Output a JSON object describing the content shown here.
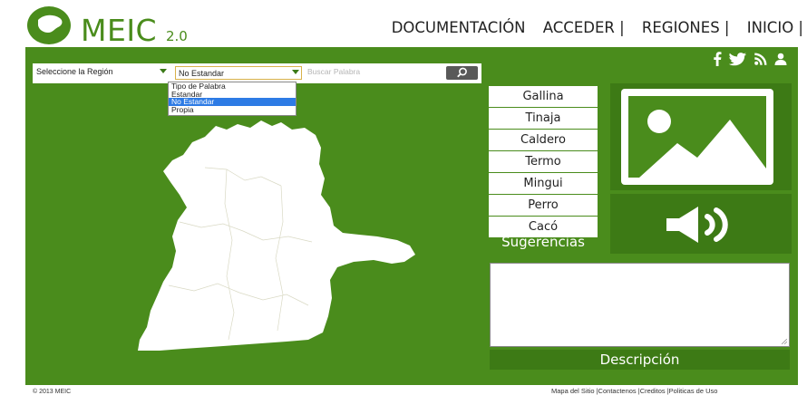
{
  "header": {
    "logo_text": "MEIC",
    "logo_version": "2.0",
    "nav": [
      "DOCUMENTACIÓN",
      "ACCEDER |",
      "REGIONES |",
      "INICIO |"
    ]
  },
  "social_icons": [
    "facebook-icon",
    "twitter-icon",
    "rss-icon",
    "user-icon"
  ],
  "search": {
    "region_select": "Seleccione la Región",
    "type_select": "No Estandar",
    "type_options": [
      "Tipo de Palabra",
      "Estandar",
      "No Estandar",
      "Propia"
    ],
    "type_selected_index": 2,
    "placeholder": "Buscar Palabra"
  },
  "words": [
    "Gallina",
    "Tinaja",
    "Caldero",
    "Termo",
    "Mingui",
    "Perro",
    "Cacó"
  ],
  "suggestions_label": "Sugerencias",
  "description_label": "Descripción",
  "description_value": "",
  "footer": {
    "copyright": "© 2013 MEIC",
    "links": "Mapa del Sitio |Contactenos |Creditos |Politicas de Uso"
  },
  "colors": {
    "brand_green": "#4a8c1c",
    "dark_green": "#3d7a15",
    "selection_blue": "#2d7be5"
  }
}
